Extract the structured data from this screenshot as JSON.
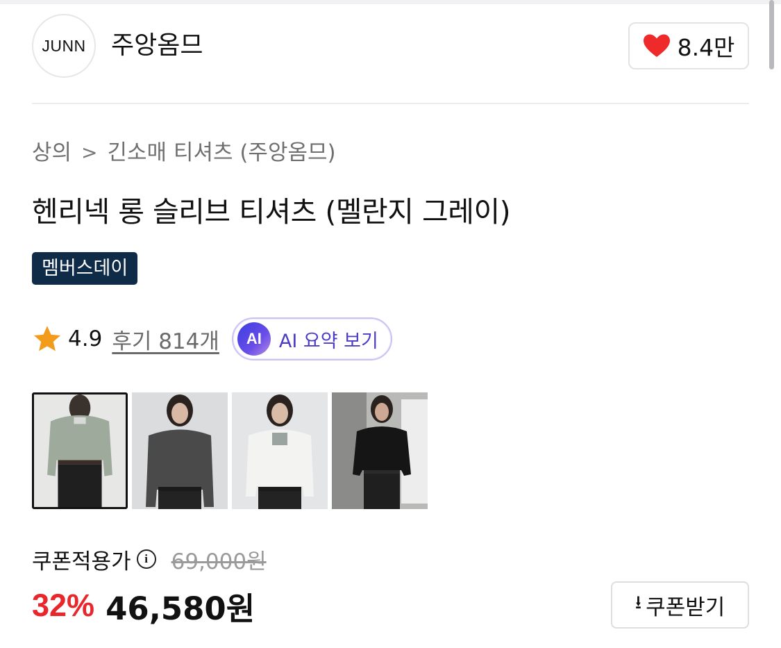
{
  "brand": {
    "logo_text": "JUNN",
    "name": "주앙옴므",
    "like_count": "8.4만"
  },
  "breadcrumb": {
    "level1": "상의",
    "separator": ">",
    "level2": "긴소매 티셔츠 (주앙옴므)"
  },
  "product": {
    "title": "헨리넥 롱 슬리브 티셔츠 (멜란지 그레이)",
    "badge": "멤버스데이",
    "rating": "4.9",
    "reviews": "후기 814개",
    "ai_summary_icon": "AI",
    "ai_summary_label": "AI 요약 보기"
  },
  "thumbnails": [
    {
      "color": "melange gray",
      "selected": true
    },
    {
      "color": "charcoal"
    },
    {
      "color": "white"
    },
    {
      "color": "black"
    }
  ],
  "pricing": {
    "label": "쿠폰적용가",
    "info_icon": "i",
    "original_price": "69,000원",
    "discount": "32%",
    "sale_price": "46,580원",
    "coupon_button": "쿠폰받기",
    "coupon_icon": "⭳"
  },
  "colors": {
    "like_heart": "#ee2a2a",
    "badge_bg": "#0e2c48",
    "discount": "#e8272d",
    "star": "#f39c1c",
    "ai_accent": "#4b3cc8"
  }
}
